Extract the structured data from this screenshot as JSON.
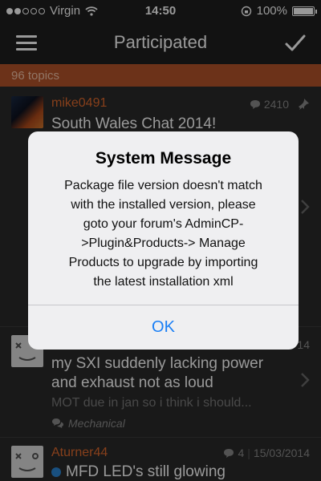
{
  "status_bar": {
    "carrier": "Virgin",
    "time": "14:50",
    "battery": "100%"
  },
  "nav": {
    "title": "Participated",
    "menu_icon": "hamburger-icon",
    "confirm_icon": "checkmark-icon"
  },
  "count_bar": {
    "text": "96 topics"
  },
  "topics": [
    {
      "username": "mike0491",
      "replies": "2410",
      "title": "South Wales Chat 2014!"
    },
    {
      "title_lines": [
        "my SXI suddenly lacking power",
        "and exhaust not as loud"
      ],
      "preview": "MOT due in jan so i think i should...",
      "category": "Mechanical",
      "date_partial": "14"
    },
    {
      "username": "Aturner44",
      "replies": "4",
      "date": "15/03/2014",
      "title": "MFD LED's still glowing"
    }
  ],
  "dialog": {
    "title": "System Message",
    "message_lines": [
      "Package file version doesn't match",
      "with the installed version, please",
      "goto your forum's AdminCP-",
      ">Plugin&Products-> Manage",
      "Products to upgrade by importing",
      "the latest installation xml"
    ],
    "ok_label": "OK"
  },
  "colors": {
    "accent_orange": "#b5542a",
    "username_orange": "#e06a2d",
    "ios_blue": "#1a7ff5",
    "background": "#2b2b2b"
  }
}
